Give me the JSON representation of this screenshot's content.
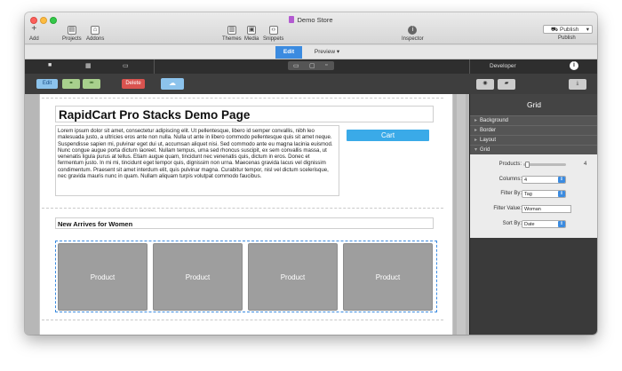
{
  "window": {
    "title": "Demo Store"
  },
  "toolbar": {
    "add": "Add",
    "projects": "Projects",
    "addons": "Addons",
    "themes": "Themes",
    "media": "Media",
    "snippets": "Snippets",
    "inspector": "Inspector",
    "publish_button": "Publish",
    "publish_label": "Publish"
  },
  "modes": {
    "edit": "Edit",
    "preview": "Preview"
  },
  "developer": {
    "label": "Developer"
  },
  "edit_tools": {
    "edit": "Edit",
    "delete": "Delete"
  },
  "page": {
    "heading": "RapidCart Pro Stacks Demo Page",
    "lorem": "Lorem ipsum dolor sit amet, consectetur adipiscing elit. Ut pellentesque, libero id semper convallis, nibh leo malesuada justo, a ultricies eros ante non nulla. Nulla ut ante in libero commodo pellentesque quis sit amet neque. Suspendisse sapien mi, pulvinar eget dui ut, accumsan aliquet nisi. Sed commodo ante eu magna lacinia euismod. Nunc congue augue porta dictum laoreet. Nullam tempus, urna sed rhoncus suscipit, ex sem convallis massa, ut venenatis ligula purus at tellus. Etiam augue quam, tincidunt nec venenatis quis, dictum in eros. Donec et fermentum justo. In mi mi, tincidunt eget tempor quis, dignissim non urna. Maecenas gravida lacus vel dignissim condimentum. Praesent sit amet interdum elit, quis pulvinar magna. Curabitur tempor, nisl vel dictum scelerisque, nec gravida mauris nunc in quam. Nullam aliquam turpis volutpat commodo faucibus.",
    "cart": "Cart",
    "subheading": "New Arrives for Women",
    "products": [
      "Product",
      "Product",
      "Product",
      "Product"
    ]
  },
  "inspector": {
    "title": "Grid",
    "sections": [
      "Background",
      "Border",
      "Layout",
      "Grid"
    ],
    "fields": {
      "products_label": "Products:",
      "products_value": "4",
      "products_fraction": 0.05,
      "columns_label": "Columns:",
      "columns_value": "4",
      "filter_by_label": "Filter By:",
      "filter_by_value": "Tag",
      "filter_value_label": "Filter Value:",
      "filter_value_value": "Woman",
      "sort_by_label": "Sort By:",
      "sort_by_value": "Date"
    }
  },
  "colors": {
    "accent": "#3b8be0",
    "cart": "#3aaae8",
    "delete": "#d9534f",
    "product_tile": "#9e9e9e"
  }
}
